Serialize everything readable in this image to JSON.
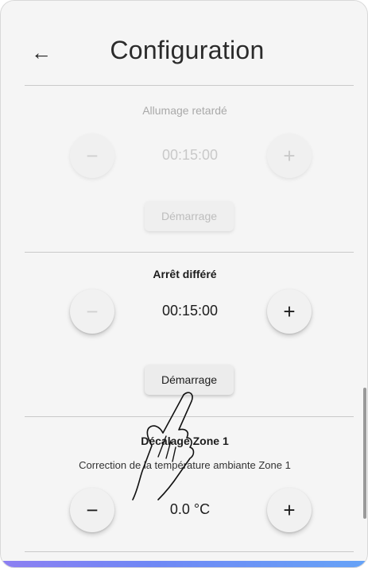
{
  "header": {
    "title": "Configuration",
    "back_icon": "arrow-left-icon"
  },
  "delayed_start": {
    "title": "Allumage retardé",
    "value": "00:15:00",
    "start_label": "Démarrage",
    "enabled": false
  },
  "deferred_stop": {
    "title": "Arrêt différé",
    "value": "00:15:00",
    "start_label": "Démarrage",
    "enabled": true
  },
  "zone1": {
    "title": "Décalage Zone 1",
    "subtitle": "Correction de la température ambiante Zone 1",
    "value": "0.0 °C"
  },
  "icons": {
    "minus": "−",
    "plus": "+",
    "back": "←"
  },
  "colors": {
    "accent_gradient_start": "#8d7ff2",
    "accent_gradient_end": "#66a3f7",
    "background": "#f5f5f5"
  }
}
